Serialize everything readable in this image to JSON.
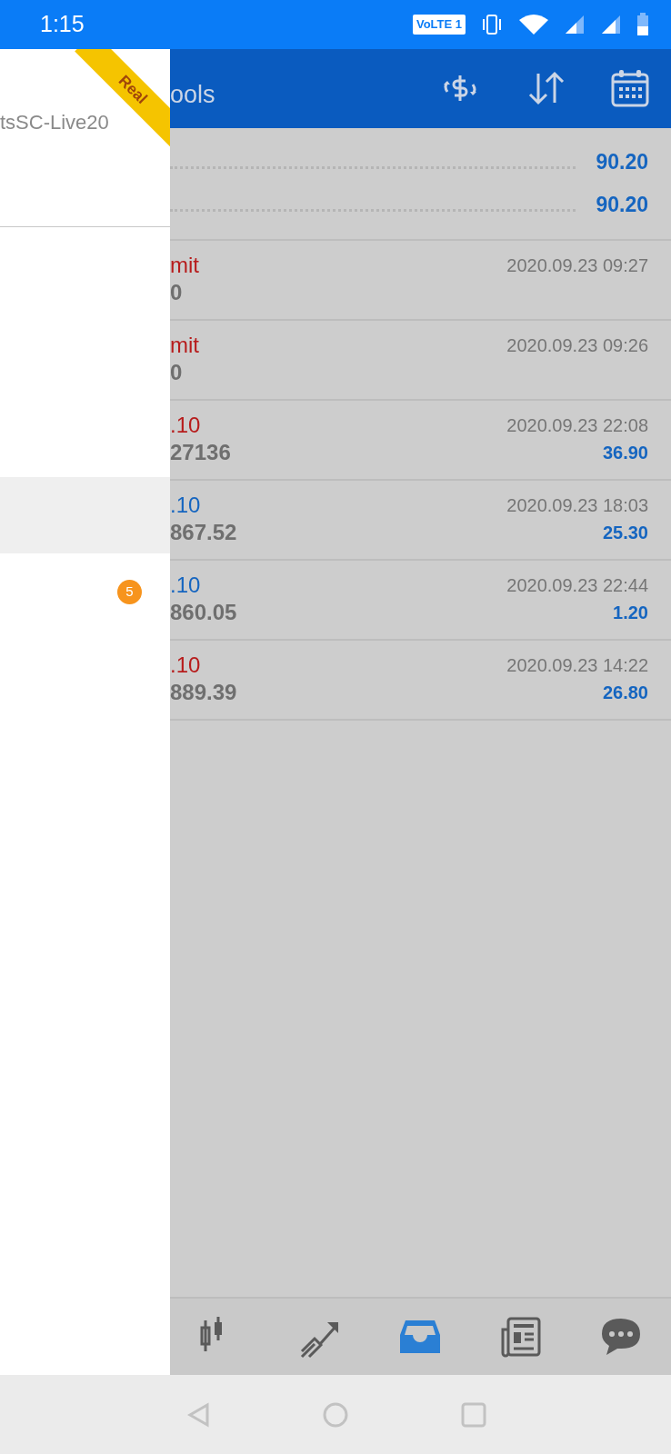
{
  "status_bar": {
    "time": "1:15",
    "network_badge": "VoLTE 1"
  },
  "drawer": {
    "ribbon": "Real",
    "account": "tsSC-Live20",
    "menu_items": [
      {
        "selected": true
      },
      {
        "selected": false,
        "badge": "5"
      }
    ]
  },
  "app_bar": {
    "title": "ools"
  },
  "summary": [
    {
      "value": "90.20"
    },
    {
      "value": "90.20"
    }
  ],
  "orders": [
    {
      "line_1": "mit",
      "color": "#b71c1c",
      "line_2": "0",
      "time": "2020.09.23 09:27"
    },
    {
      "line_1": "mit",
      "color": "#b71c1c",
      "line_2": "0",
      "time": "2020.09.23 09:26"
    },
    {
      "line_1": ".10",
      "color": "#b71c1c",
      "line_2": "27136",
      "time": "2020.09.23 22:08",
      "profit": "36.90"
    },
    {
      "line_1": ".10",
      "color": "#1565c0",
      "line_2": "867.52",
      "time": "2020.09.23 18:03",
      "profit": "25.30"
    },
    {
      "line_1": ".10",
      "color": "#1565c0",
      "line_2": "860.05",
      "time": "2020.09.23 22:44",
      "profit": "1.20"
    },
    {
      "line_1": ".10",
      "color": "#b71c1c",
      "line_2": "889.39",
      "time": "2020.09.23 14:22",
      "profit": "26.80"
    }
  ],
  "bottom_nav": [
    {
      "kind": "candles",
      "selected": false
    },
    {
      "kind": "trend",
      "selected": false
    },
    {
      "kind": "inbox",
      "selected": true
    },
    {
      "kind": "news",
      "selected": false
    },
    {
      "kind": "chat",
      "selected": false
    }
  ]
}
